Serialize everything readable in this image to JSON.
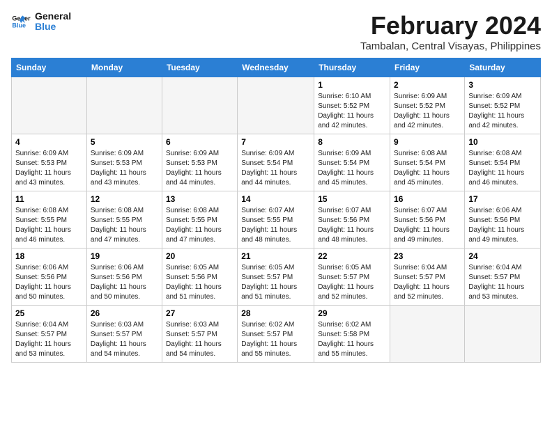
{
  "logo": {
    "line1": "General",
    "line2": "Blue"
  },
  "title": "February 2024",
  "subtitle": "Tambalan, Central Visayas, Philippines",
  "days_of_week": [
    "Sunday",
    "Monday",
    "Tuesday",
    "Wednesday",
    "Thursday",
    "Friday",
    "Saturday"
  ],
  "weeks": [
    [
      {
        "day": "",
        "data": ""
      },
      {
        "day": "",
        "data": ""
      },
      {
        "day": "",
        "data": ""
      },
      {
        "day": "",
        "data": ""
      },
      {
        "day": "1",
        "data": "Sunrise: 6:10 AM\nSunset: 5:52 PM\nDaylight: 11 hours and 42 minutes."
      },
      {
        "day": "2",
        "data": "Sunrise: 6:09 AM\nSunset: 5:52 PM\nDaylight: 11 hours and 42 minutes."
      },
      {
        "day": "3",
        "data": "Sunrise: 6:09 AM\nSunset: 5:52 PM\nDaylight: 11 hours and 42 minutes."
      }
    ],
    [
      {
        "day": "4",
        "data": "Sunrise: 6:09 AM\nSunset: 5:53 PM\nDaylight: 11 hours and 43 minutes."
      },
      {
        "day": "5",
        "data": "Sunrise: 6:09 AM\nSunset: 5:53 PM\nDaylight: 11 hours and 43 minutes."
      },
      {
        "day": "6",
        "data": "Sunrise: 6:09 AM\nSunset: 5:53 PM\nDaylight: 11 hours and 44 minutes."
      },
      {
        "day": "7",
        "data": "Sunrise: 6:09 AM\nSunset: 5:54 PM\nDaylight: 11 hours and 44 minutes."
      },
      {
        "day": "8",
        "data": "Sunrise: 6:09 AM\nSunset: 5:54 PM\nDaylight: 11 hours and 45 minutes."
      },
      {
        "day": "9",
        "data": "Sunrise: 6:08 AM\nSunset: 5:54 PM\nDaylight: 11 hours and 45 minutes."
      },
      {
        "day": "10",
        "data": "Sunrise: 6:08 AM\nSunset: 5:54 PM\nDaylight: 11 hours and 46 minutes."
      }
    ],
    [
      {
        "day": "11",
        "data": "Sunrise: 6:08 AM\nSunset: 5:55 PM\nDaylight: 11 hours and 46 minutes."
      },
      {
        "day": "12",
        "data": "Sunrise: 6:08 AM\nSunset: 5:55 PM\nDaylight: 11 hours and 47 minutes."
      },
      {
        "day": "13",
        "data": "Sunrise: 6:08 AM\nSunset: 5:55 PM\nDaylight: 11 hours and 47 minutes."
      },
      {
        "day": "14",
        "data": "Sunrise: 6:07 AM\nSunset: 5:55 PM\nDaylight: 11 hours and 48 minutes."
      },
      {
        "day": "15",
        "data": "Sunrise: 6:07 AM\nSunset: 5:56 PM\nDaylight: 11 hours and 48 minutes."
      },
      {
        "day": "16",
        "data": "Sunrise: 6:07 AM\nSunset: 5:56 PM\nDaylight: 11 hours and 49 minutes."
      },
      {
        "day": "17",
        "data": "Sunrise: 6:06 AM\nSunset: 5:56 PM\nDaylight: 11 hours and 49 minutes."
      }
    ],
    [
      {
        "day": "18",
        "data": "Sunrise: 6:06 AM\nSunset: 5:56 PM\nDaylight: 11 hours and 50 minutes."
      },
      {
        "day": "19",
        "data": "Sunrise: 6:06 AM\nSunset: 5:56 PM\nDaylight: 11 hours and 50 minutes."
      },
      {
        "day": "20",
        "data": "Sunrise: 6:05 AM\nSunset: 5:56 PM\nDaylight: 11 hours and 51 minutes."
      },
      {
        "day": "21",
        "data": "Sunrise: 6:05 AM\nSunset: 5:57 PM\nDaylight: 11 hours and 51 minutes."
      },
      {
        "day": "22",
        "data": "Sunrise: 6:05 AM\nSunset: 5:57 PM\nDaylight: 11 hours and 52 minutes."
      },
      {
        "day": "23",
        "data": "Sunrise: 6:04 AM\nSunset: 5:57 PM\nDaylight: 11 hours and 52 minutes."
      },
      {
        "day": "24",
        "data": "Sunrise: 6:04 AM\nSunset: 5:57 PM\nDaylight: 11 hours and 53 minutes."
      }
    ],
    [
      {
        "day": "25",
        "data": "Sunrise: 6:04 AM\nSunset: 5:57 PM\nDaylight: 11 hours and 53 minutes."
      },
      {
        "day": "26",
        "data": "Sunrise: 6:03 AM\nSunset: 5:57 PM\nDaylight: 11 hours and 54 minutes."
      },
      {
        "day": "27",
        "data": "Sunrise: 6:03 AM\nSunset: 5:57 PM\nDaylight: 11 hours and 54 minutes."
      },
      {
        "day": "28",
        "data": "Sunrise: 6:02 AM\nSunset: 5:57 PM\nDaylight: 11 hours and 55 minutes."
      },
      {
        "day": "29",
        "data": "Sunrise: 6:02 AM\nSunset: 5:58 PM\nDaylight: 11 hours and 55 minutes."
      },
      {
        "day": "",
        "data": ""
      },
      {
        "day": "",
        "data": ""
      }
    ]
  ]
}
